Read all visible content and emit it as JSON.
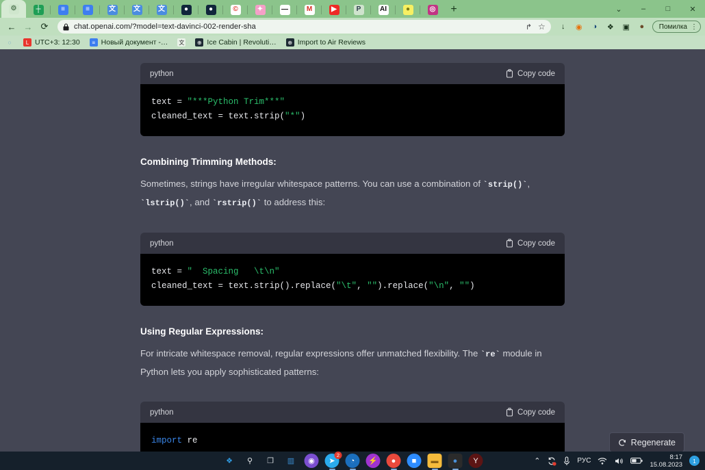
{
  "browser": {
    "tabs": [
      {
        "name": "tab-settings-gear",
        "icon": "gear-icon",
        "bg": "#cfe6cd",
        "fg": "#5a7f5c",
        "glyph": "⚙",
        "active": true
      },
      {
        "name": "tab-google-sheets",
        "icon": "sheets-icon",
        "bg": "#1e9e55",
        "fg": "#ffffff",
        "glyph": "┼",
        "active": false
      },
      {
        "name": "tab-google-docs-1",
        "icon": "docs-icon",
        "bg": "#3d7ef0",
        "fg": "#ffffff",
        "glyph": "≡",
        "active": false
      },
      {
        "name": "tab-google-docs-2",
        "icon": "docs-icon",
        "bg": "#3d7ef0",
        "fg": "#ffffff",
        "glyph": "≡",
        "active": false
      },
      {
        "name": "tab-translate-1",
        "icon": "translate-icon",
        "bg": "#4a8ce0",
        "fg": "#ffffff",
        "glyph": "文",
        "active": false
      },
      {
        "name": "tab-translate-2",
        "icon": "translate-icon",
        "bg": "#4a8ce0",
        "fg": "#ffffff",
        "glyph": "文",
        "active": false
      },
      {
        "name": "tab-translate-3",
        "icon": "translate-icon",
        "bg": "#4a8ce0",
        "fg": "#ffffff",
        "glyph": "文",
        "active": false
      },
      {
        "name": "tab-chatgpt-1",
        "icon": "chatgpt-dark-icon",
        "bg": "#10263b",
        "fg": "#ffffff",
        "glyph": "●",
        "active": false
      },
      {
        "name": "tab-chatgpt-2",
        "icon": "chatgpt-dark-icon",
        "bg": "#10263b",
        "fg": "#ffffff",
        "glyph": "●",
        "active": false
      },
      {
        "name": "tab-copyright",
        "icon": "copyright-icon",
        "bg": "#ffffff",
        "fg": "#e0322a",
        "glyph": "©",
        "active": false
      },
      {
        "name": "tab-sparkle",
        "icon": "sparkle-icon",
        "bg": "#f5a0c8",
        "fg": "#ffffff",
        "glyph": "✦",
        "active": false
      },
      {
        "name": "tab-bone",
        "icon": "bone-icon",
        "bg": "#ffffff",
        "fg": "#101010",
        "glyph": "—",
        "active": false
      },
      {
        "name": "tab-gmail",
        "icon": "gmail-icon",
        "bg": "#ffffff",
        "fg": "#d93025",
        "glyph": "M",
        "active": false
      },
      {
        "name": "tab-youtube",
        "icon": "youtube-icon",
        "bg": "#ee2b26",
        "fg": "#ffffff",
        "glyph": "▶",
        "active": false
      },
      {
        "name": "tab-paypal",
        "icon": "paypal-icon",
        "bg": "#cfe3cd",
        "fg": "#2c3b4d",
        "glyph": "P",
        "active": false
      },
      {
        "name": "tab-ai",
        "icon": "ai-icon",
        "bg": "#ffffff",
        "fg": "#111111",
        "glyph": "AI",
        "active": false
      },
      {
        "name": "tab-snapchat",
        "icon": "snapchat-icon",
        "bg": "#f7f062",
        "fg": "#7c7a16",
        "glyph": "●",
        "active": false
      },
      {
        "name": "tab-instagram",
        "icon": "instagram-icon",
        "bg": "#c13584",
        "fg": "#ffffff",
        "glyph": "◎",
        "active": false
      }
    ],
    "new_tab_label": "+",
    "window_controls": [
      {
        "name": "tab-search-button",
        "glyph": "⌄"
      },
      {
        "name": "minimize-button",
        "glyph": "–"
      },
      {
        "name": "maximize-button",
        "glyph": "□"
      },
      {
        "name": "close-button",
        "glyph": "✕"
      }
    ],
    "nav": {
      "back_glyph": "←",
      "forward_glyph": "→",
      "reload_glyph": "⟳"
    },
    "omnibox": {
      "lock_glyph": "🔒",
      "url": "chat.openai.com/?model=text-davinci-002-render-sha",
      "share_glyph": "↱",
      "bookmark_glyph": "☆"
    },
    "toolbar_icons": [
      {
        "name": "download-icon",
        "glyph": "↓",
        "color": "#17311a"
      },
      {
        "name": "firefox-extension-icon",
        "glyph": "◉",
        "color": "#e8720c"
      },
      {
        "name": "moon-extension-icon",
        "glyph": "◑",
        "color": "#1b4a7a"
      },
      {
        "name": "extensions-puzzle-icon",
        "glyph": "❖",
        "color": "#17311a"
      },
      {
        "name": "sidebar-icon",
        "glyph": "▣",
        "color": "#17311a"
      },
      {
        "name": "profile-avatar",
        "glyph": "●",
        "color": "#6b4a2a"
      }
    ],
    "profile_pill": {
      "label": "Помилка",
      "menu_glyph": "⋮"
    },
    "bookmarks": [
      {
        "name": "bookmark-loading",
        "label": "",
        "icon_bg": "#c5e0c5",
        "icon_fg": "#2a7cc7",
        "glyph": "◌"
      },
      {
        "name": "bookmark-utc-clock",
        "label": "UTC+3: 12:30",
        "icon_bg": "#e8352c",
        "icon_fg": "#ffffff",
        "glyph": "L"
      },
      {
        "name": "bookmark-new-document",
        "label": "Новый документ -…",
        "icon_bg": "#3d7ef0",
        "icon_fg": "#ffffff",
        "glyph": "≡"
      },
      {
        "name": "bookmark-translate",
        "label": "",
        "icon_bg": "#e9f2e8",
        "icon_fg": "#2b2b2b",
        "glyph": "文"
      },
      {
        "name": "bookmark-ice-cabin",
        "label": "Ice Cabin | Revoluti…",
        "icon_bg": "#1d2a33",
        "icon_fg": "#ffffff",
        "glyph": "⊕"
      },
      {
        "name": "bookmark-import-air-reviews",
        "label": "Import to Air Reviews",
        "icon_bg": "#1d2a33",
        "icon_fg": "#ffffff",
        "glyph": "⊕"
      }
    ]
  },
  "page": {
    "code_label": "python",
    "copy_label": "Copy code",
    "copy_icon": "clipboard-icon",
    "blocks": [
      {
        "language": "python",
        "lines": [
          [
            {
              "t": "text = ",
              "c": ""
            },
            {
              "t": "\"***Python Trim***\"",
              "c": "tok-str"
            }
          ],
          [
            {
              "t": "cleaned_text = text.strip(",
              "c": ""
            },
            {
              "t": "\"*\"",
              "c": "tok-str"
            },
            {
              "t": ")",
              "c": ""
            }
          ]
        ]
      },
      {
        "language": "python",
        "lines": [
          [
            {
              "t": "text = ",
              "c": ""
            },
            {
              "t": "\"  Spacing   \\t\\n\"",
              "c": "tok-str"
            }
          ],
          [
            {
              "t": "cleaned_text = text.strip().replace(",
              "c": ""
            },
            {
              "t": "\"\\t\"",
              "c": "tok-str"
            },
            {
              "t": ", ",
              "c": ""
            },
            {
              "t": "\"\"",
              "c": "tok-str"
            },
            {
              "t": ").replace(",
              "c": ""
            },
            {
              "t": "\"\\n\"",
              "c": "tok-str"
            },
            {
              "t": ", ",
              "c": ""
            },
            {
              "t": "\"\"",
              "c": "tok-str"
            },
            {
              "t": ")",
              "c": ""
            }
          ]
        ]
      },
      {
        "language": "python",
        "lines": [
          [
            {
              "t": "import ",
              "c": "tok-kw"
            },
            {
              "t": "re",
              "c": ""
            }
          ]
        ]
      }
    ],
    "section_1": {
      "heading": "Combining Trimming Methods:",
      "paragraph_parts": [
        {
          "t": "Sometimes, strings have irregular whitespace patterns. You can use a combination of ",
          "code": false
        },
        {
          "t": "`strip()`",
          "code": true
        },
        {
          "t": ", ",
          "code": false
        },
        {
          "t": "`lstrip()`",
          "code": true
        },
        {
          "t": ", and ",
          "code": false
        },
        {
          "t": "`rstrip()`",
          "code": true
        },
        {
          "t": " to address this:",
          "code": false
        }
      ]
    },
    "section_2": {
      "heading": "Using Regular Expressions:",
      "paragraph_parts": [
        {
          "t": "For intricate whitespace removal, regular expressions offer unmatched flexibility. The ",
          "code": false
        },
        {
          "t": "`re`",
          "code": true
        },
        {
          "t": " module in Python lets you apply sophisticated patterns:",
          "code": false
        }
      ]
    },
    "regenerate": {
      "label": "Regenerate",
      "icon": "refresh-icon"
    }
  },
  "taskbar": {
    "items": [
      {
        "name": "start-button",
        "icon": "windows-logo-icon",
        "bg": "#15202b",
        "fg": "#2f9ae0",
        "glyph": "❖",
        "running": false,
        "badge": ""
      },
      {
        "name": "search-button",
        "icon": "search-icon",
        "bg": "#15202b",
        "fg": "#e8eaec",
        "glyph": "⚲",
        "running": false,
        "badge": ""
      },
      {
        "name": "task-view-button",
        "icon": "task-view-icon",
        "bg": "#15202b",
        "fg": "#cfd4d8",
        "glyph": "❐",
        "running": false,
        "badge": ""
      },
      {
        "name": "widgets-button",
        "icon": "widgets-icon",
        "bg": "#15202b",
        "fg": "#3b8fd4",
        "glyph": "▥",
        "running": false,
        "badge": ""
      },
      {
        "name": "taskbar-app-viber",
        "icon": "viber-icon",
        "bg": "#7b4fd1",
        "fg": "#ffffff",
        "glyph": "◉",
        "running": false,
        "badge": ""
      },
      {
        "name": "taskbar-app-telegram",
        "icon": "telegram-icon",
        "bg": "#2aabee",
        "fg": "#ffffff",
        "glyph": "➤",
        "running": true,
        "badge": "2"
      },
      {
        "name": "taskbar-app-edge",
        "icon": "edge-icon",
        "bg": "#1b6fbd",
        "fg": "#ffffff",
        "glyph": "◔",
        "running": true,
        "badge": ""
      },
      {
        "name": "taskbar-app-messenger",
        "icon": "messenger-icon",
        "bg": "#a033d0",
        "fg": "#ffffff",
        "glyph": "⚡",
        "running": false,
        "badge": ""
      },
      {
        "name": "taskbar-app-chrome-1",
        "icon": "chrome-icon",
        "bg": "#e9493c",
        "fg": "#ffffff",
        "glyph": "●",
        "running": true,
        "badge": ""
      },
      {
        "name": "taskbar-app-zoom",
        "icon": "zoom-icon",
        "bg": "#2d8cff",
        "fg": "#ffffff",
        "glyph": "■",
        "running": false,
        "badge": ""
      },
      {
        "name": "taskbar-app-file-explorer",
        "icon": "folder-icon",
        "bg": "#f5bb3c",
        "fg": "#8a6012",
        "glyph": "▬",
        "running": true,
        "badge": ""
      },
      {
        "name": "taskbar-app-chrome-2",
        "icon": "chrome-icon",
        "bg": "#2b2b2b",
        "fg": "#4a90d9",
        "glyph": "●",
        "running": true,
        "badge": ""
      },
      {
        "name": "taskbar-app-yandex",
        "icon": "yandex-icon",
        "bg": "#5c1414",
        "fg": "#ffffff",
        "glyph": "Y",
        "running": false,
        "badge": ""
      }
    ],
    "tray": {
      "chevron_glyph": "⌃",
      "sync_icon": "sync-icon",
      "sync_glyph": "⟳",
      "mic_icon": "microphone-icon",
      "mic_glyph": "♀",
      "language": "РУС",
      "wifi_icon": "wifi-icon",
      "wifi_glyph": "◠",
      "volume_icon": "volume-icon",
      "volume_glyph": "◁",
      "battery_icon": "battery-icon",
      "battery_glyph": "■",
      "time": "8:17",
      "date": "15.08.2023",
      "notification_count": "1"
    }
  }
}
